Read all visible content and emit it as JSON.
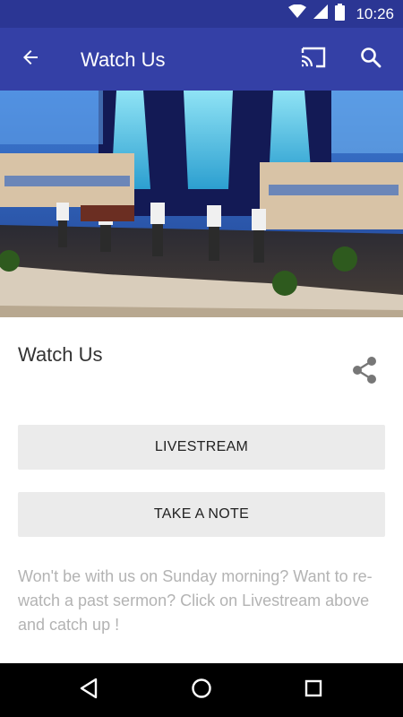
{
  "status_bar": {
    "time": "10:26",
    "icons": [
      "wifi-icon",
      "cell-signal-icon",
      "battery-icon"
    ]
  },
  "app_bar": {
    "title": "Watch Us",
    "icons": [
      "back-arrow-icon",
      "cast-icon",
      "search-icon"
    ],
    "background": "#3440a6"
  },
  "content": {
    "title": "Watch Us",
    "share_icon": "share-icon",
    "buttons": {
      "livestream": "LIVESTREAM",
      "take_note": "TAKE A NOTE"
    },
    "description": "Won't be with us on Sunday morning?  Want to re-watch a past sermon?  Click on Livestream above and catch up !"
  },
  "nav_bar": {
    "icons": [
      "nav-back-icon",
      "nav-home-icon",
      "nav-recent-apps-icon"
    ]
  },
  "colors": {
    "status_bar": "#2b3694",
    "app_bar": "#3440a6",
    "button_bg": "#ebebeb",
    "description_text": "#b3b3b3"
  }
}
